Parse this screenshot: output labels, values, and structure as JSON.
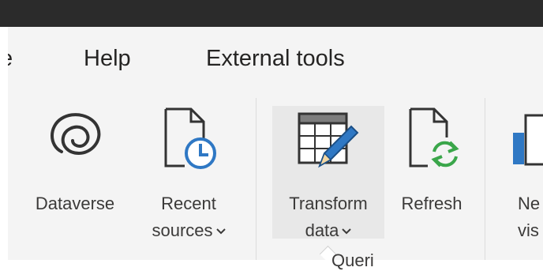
{
  "menu": {
    "partial_item": "e",
    "help": "Help",
    "external_tools": "External tools"
  },
  "ribbon": {
    "dataverse": {
      "line1": "Dataverse"
    },
    "recent_sources": {
      "line1": "Recent",
      "line2": "sources"
    },
    "transform_data": {
      "line1": "Transform",
      "line2": "data"
    },
    "refresh": {
      "line1": "Refresh"
    },
    "new_visual": {
      "line1": "Ne",
      "line2": "vis"
    },
    "group_label_partial": "Queri"
  },
  "colors": {
    "titlebar": "#2b2b2b",
    "ribbon_bg": "#f4f4f4",
    "text": "#3b3a39",
    "icon_blue": "#2f78c4",
    "refresh_green": "#3aa64a",
    "new_visual_blue": "#2f78c4"
  },
  "icons": [
    "dataverse-icon",
    "recent-sources-icon",
    "transform-data-icon",
    "refresh-icon",
    "new-visual-icon"
  ]
}
